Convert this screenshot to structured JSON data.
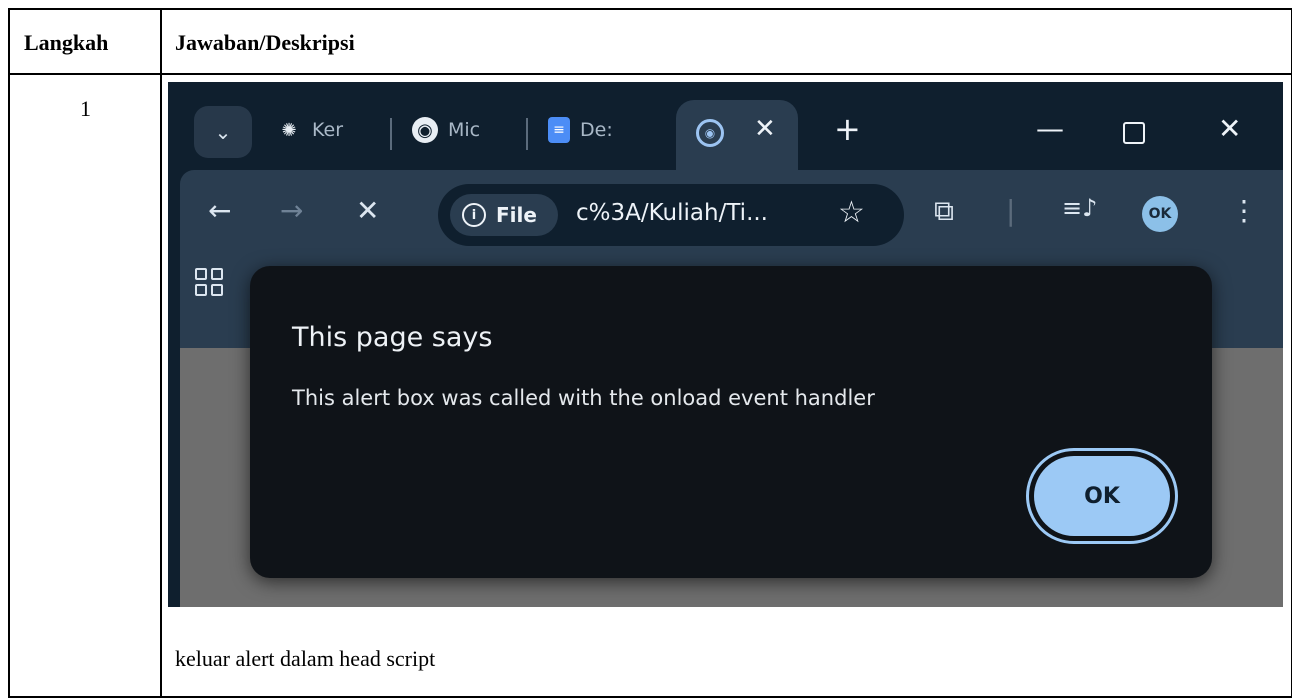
{
  "table": {
    "header_step": "Langkah",
    "header_desc": "Jawaban/Deskripsi",
    "row_number": "1",
    "caption": "keluar alert dalam head script"
  },
  "browser": {
    "tabs": [
      {
        "label": "Ker",
        "icon": "openai-icon"
      },
      {
        "label": "Mic",
        "icon": "globe-icon"
      },
      {
        "label": "De:",
        "icon": "docs-icon"
      }
    ],
    "active_tab_icon": "loading-globe-icon",
    "omnibox": {
      "chip_label": "File",
      "url": "c%3A/Kuliah/Ti..."
    },
    "colors": {
      "frame": "#0f1f2e",
      "toolbar": "#2a3d50",
      "accent": "#9cc9f5"
    }
  },
  "dialog": {
    "title": "This page says",
    "message": "This alert box was called with the onload event handler",
    "ok_label": "OK"
  }
}
